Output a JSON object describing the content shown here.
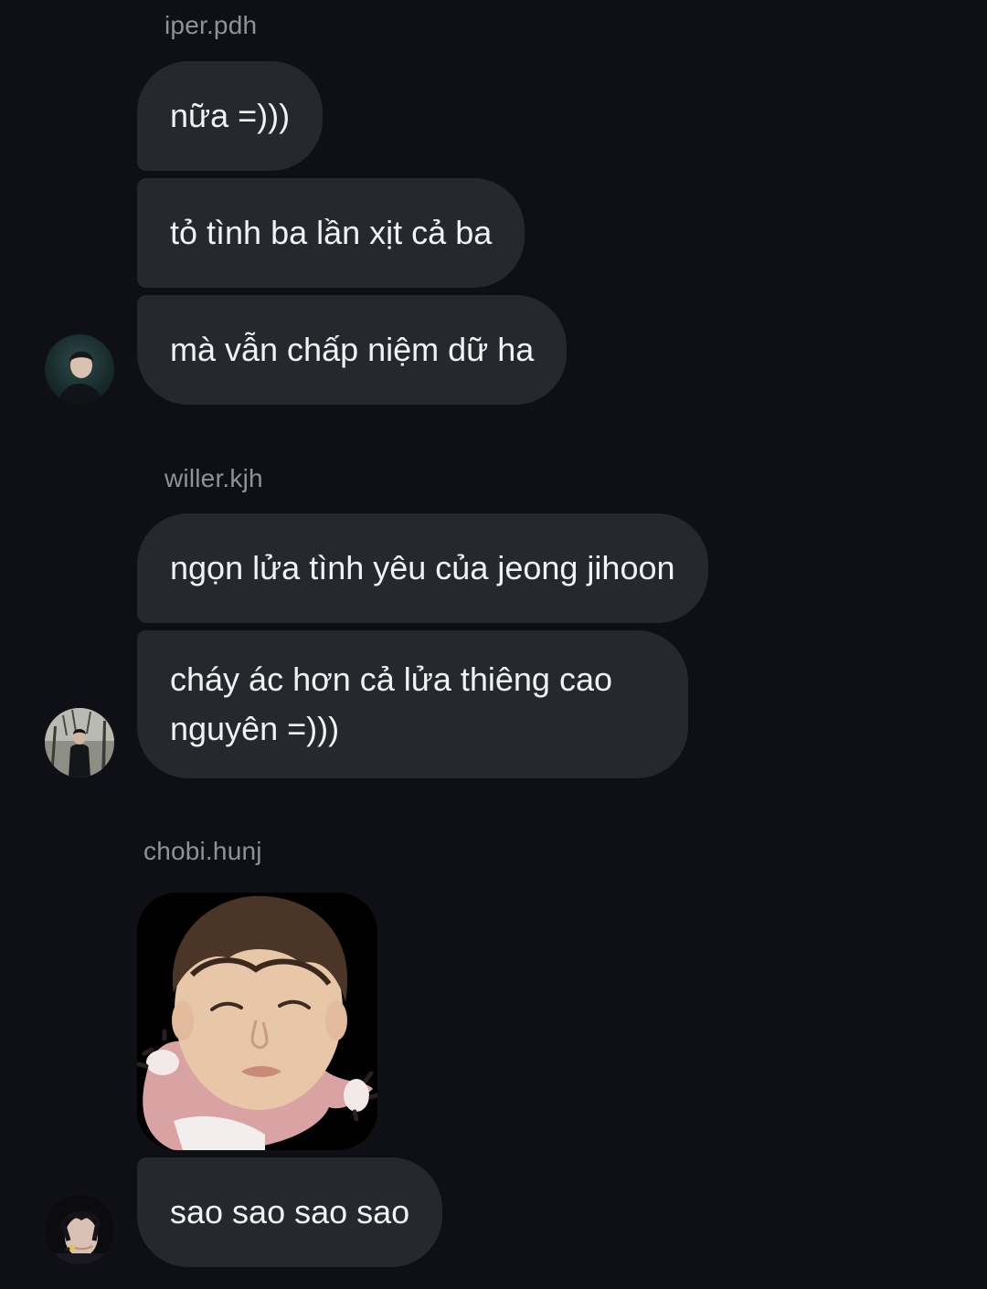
{
  "groups": [
    {
      "username": "iper.pdh",
      "messages": [
        "nữa =)))",
        "tỏ tình ba lần xịt cả ba",
        "mà vẫn chấp niệm dữ ha"
      ]
    },
    {
      "username": "willer.kjh",
      "messages": [
        "ngọn lửa tình yêu của jeong jihoon",
        "cháy ác hơn cả lửa thiêng cao nguyên =)))"
      ]
    },
    {
      "username": "chobi.hunj",
      "sticker": "sticker-image",
      "messages": [
        "sao sao sao sao"
      ]
    }
  ],
  "colors": {
    "background": "#0f1016",
    "bubble": "#26282e",
    "username": "#8f929b",
    "text": "#f2f3f5"
  }
}
